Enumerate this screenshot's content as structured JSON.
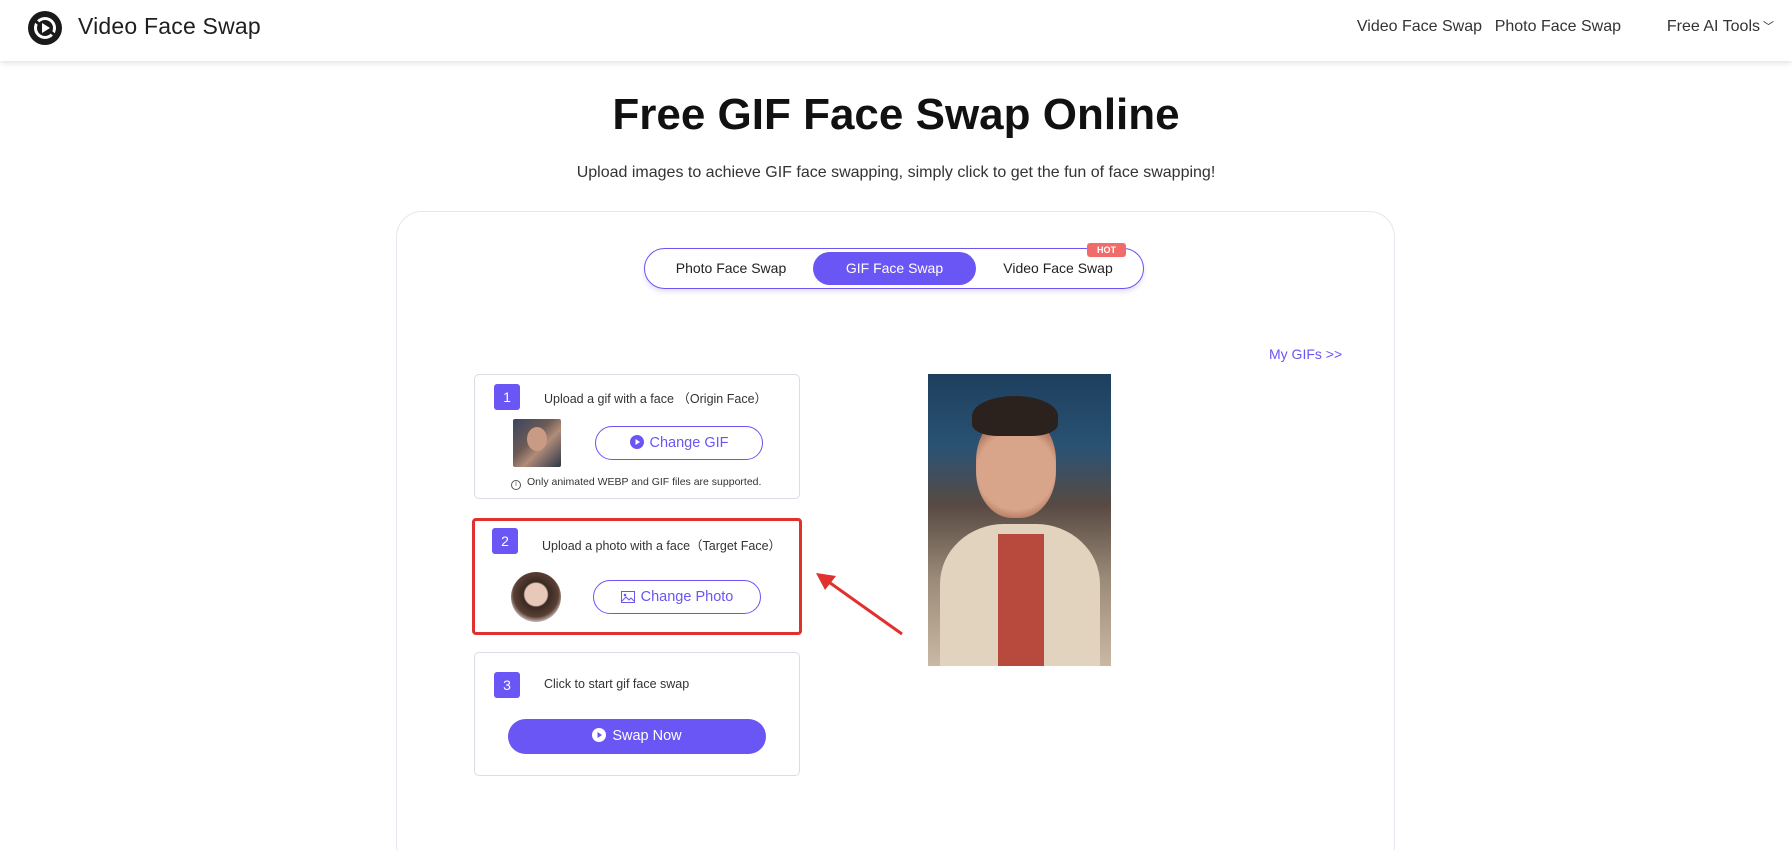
{
  "header": {
    "brand": "Video Face Swap",
    "nav": [
      "Video Face Swap",
      "Photo Face Swap",
      "Free AI Tools"
    ]
  },
  "page": {
    "title": "Free GIF Face Swap Online",
    "subtitle": "Upload images to achieve GIF face swapping, simply click to get the fun of face swapping!"
  },
  "tabs": {
    "items": [
      "Photo Face Swap",
      "GIF Face Swap",
      "Video Face Swap"
    ],
    "active": "GIF Face Swap",
    "badge": "HOT"
  },
  "my_gifs": "My GIFs >>",
  "steps": [
    {
      "num": "1",
      "label": "Upload a gif with a face （Origin Face）",
      "button": "Change GIF",
      "note": "Only animated WEBP and GIF files are supported."
    },
    {
      "num": "2",
      "label": "Upload a photo with a face（Target Face）",
      "button": "Change Photo"
    },
    {
      "num": "3",
      "label": "Click to start gif face swap",
      "button": "Swap Now"
    }
  ],
  "colors": {
    "accent": "#6a55f5",
    "highlight": "#e0312d",
    "hot_badge": "#f26b6b"
  }
}
